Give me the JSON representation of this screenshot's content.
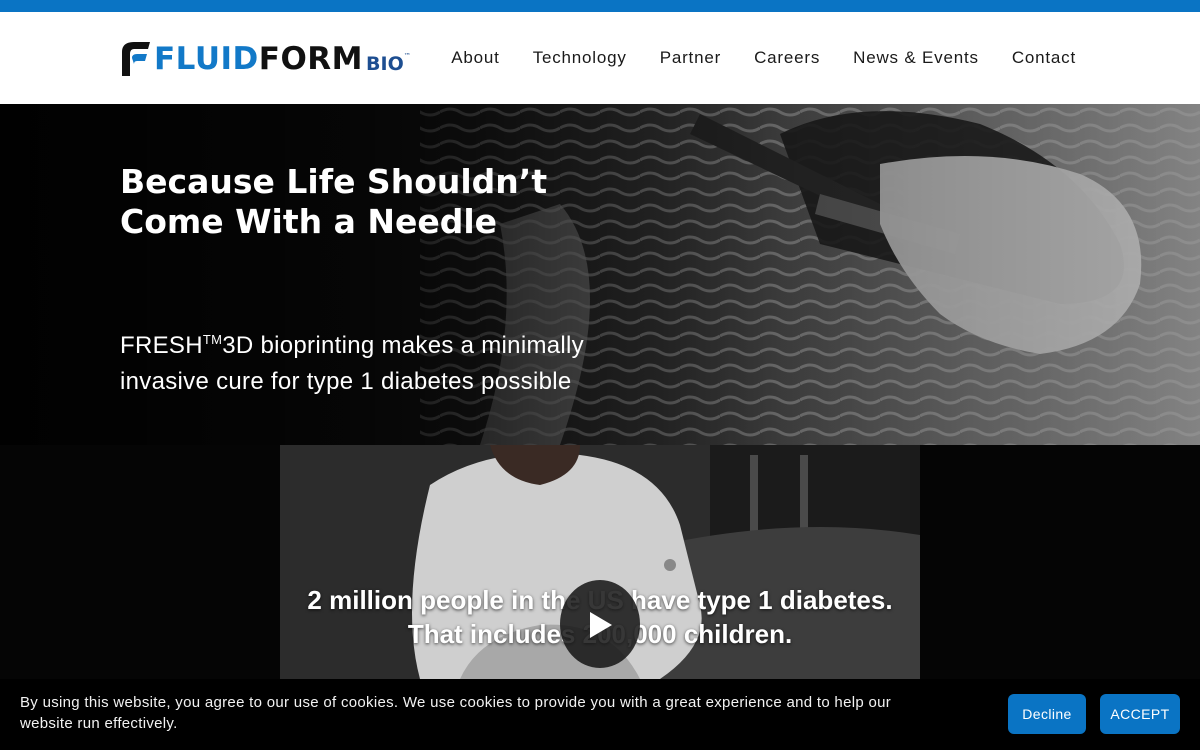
{
  "brand": {
    "name_part1": "FLUID",
    "name_part2": "FORM",
    "name_part3": "BIO",
    "trademark": "™",
    "colors": {
      "blue": "#1279c8",
      "dark_blue": "#1d4e91",
      "accent": "#0a74c4"
    }
  },
  "nav": {
    "items": [
      {
        "label": "About"
      },
      {
        "label": "Technology"
      },
      {
        "label": "Partner"
      },
      {
        "label": "Careers"
      },
      {
        "label": "News & Events"
      },
      {
        "label": "Contact"
      }
    ]
  },
  "hero": {
    "title": "Because Life Shouldn’t Come With a Needle",
    "subtitle_prefix": "FRESH",
    "subtitle_tm": "TM",
    "subtitle_rest": "3D bioprinting makes a minimally invasive cure for type 1 diabetes possible"
  },
  "video": {
    "caption_line1": "2 million people in the US have type 1 diabetes.",
    "caption_line2": "That includes 200,000 children.",
    "play_icon": "play-icon"
  },
  "cookie": {
    "text": "By using this website, you agree to our use of cookies. We use cookies to provide you with a great experience and to help our website run effectively.",
    "decline_label": "Decline",
    "accept_label": "ACCEPT"
  }
}
